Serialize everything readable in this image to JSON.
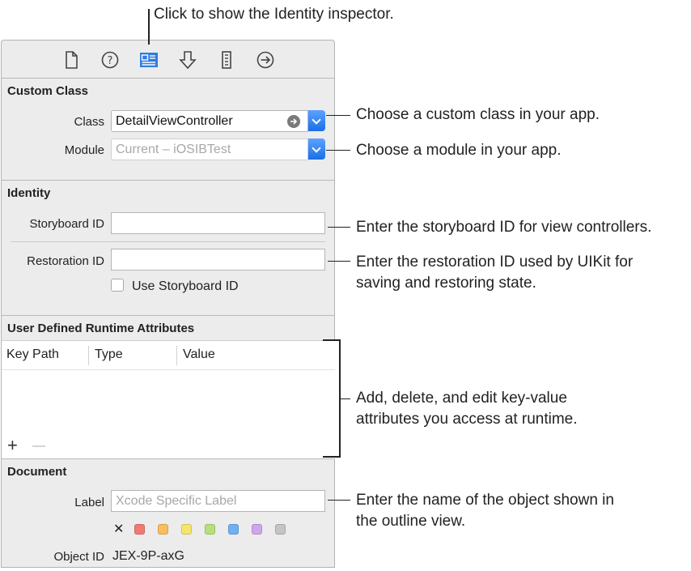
{
  "toolbar": {
    "icons": [
      "file-icon",
      "help-icon",
      "identity-icon",
      "attributes-icon",
      "size-icon",
      "connections-icon"
    ]
  },
  "custom_class": {
    "title": "Custom Class",
    "class_label": "Class",
    "class_value": "DetailViewController",
    "module_label": "Module",
    "module_placeholder": "Current – iOSIBTest"
  },
  "identity": {
    "title": "Identity",
    "storyboard_id_label": "Storyboard ID",
    "storyboard_id_value": "",
    "restoration_id_label": "Restoration ID",
    "restoration_id_value": "",
    "use_storyboard_id_label": "Use Storyboard ID"
  },
  "runtime_attributes": {
    "title": "User Defined Runtime Attributes",
    "columns": [
      "Key Path",
      "Type",
      "Value"
    ],
    "add_symbol": "+",
    "remove_symbol": "—"
  },
  "document": {
    "title": "Document",
    "label_label": "Label",
    "label_placeholder": "Xcode Specific Label",
    "clear_symbol": "✕",
    "colors": [
      "#f07a72",
      "#f8be5c",
      "#f5e66b",
      "#b6e07a",
      "#6fb0f2",
      "#cfa6ea",
      "#c4c4c4"
    ],
    "object_id_label": "Object ID",
    "object_id_value": "JEX-9P-axG"
  },
  "callouts": {
    "identity_inspector": "Click to show the Identity inspector.",
    "custom_class": "Choose a custom class in your app.",
    "module": "Choose a module in your app.",
    "storyboard_id": "Enter the storyboard ID for view controllers.",
    "restoration_id_line1": "Enter the restoration ID used by UIKit for",
    "restoration_id_line2": "saving and restoring state.",
    "runtime_line1": "Add, delete, and edit key-value",
    "runtime_line2": "attributes you access at runtime.",
    "label_line1": "Enter the name of the object shown in",
    "label_line2": "the outline view."
  }
}
